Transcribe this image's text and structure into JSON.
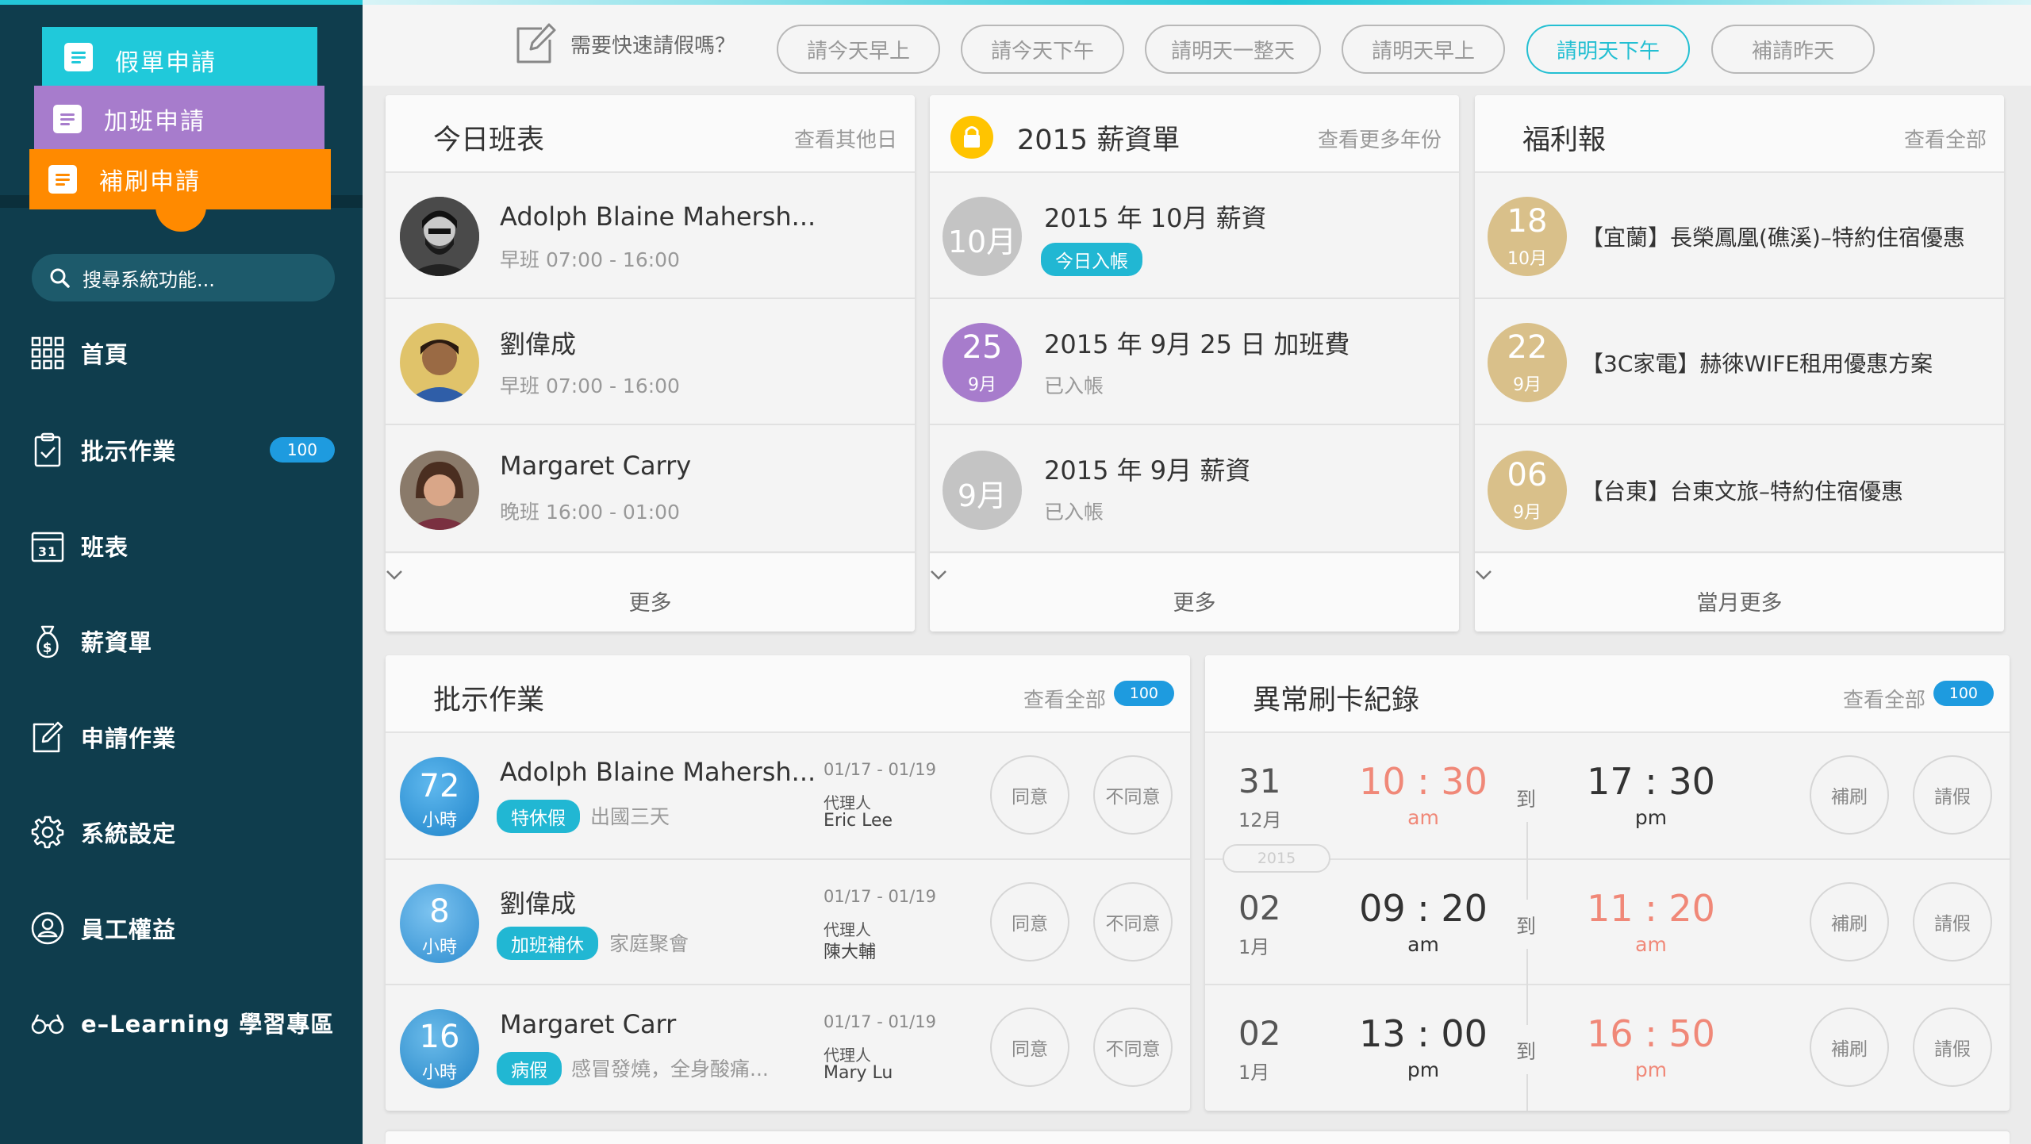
{
  "sidebar": {
    "leave_btn": "假單申請",
    "overtime_btn": "加班申請",
    "punch_btn": "補刷申請",
    "search_placeholder": "搜尋系統功能...",
    "nav": [
      {
        "label": "首頁",
        "icon": "grid-icon"
      },
      {
        "label": "批示作業",
        "icon": "clipboard-check-icon",
        "badge": "100"
      },
      {
        "label": "班表",
        "icon": "calendar-icon"
      },
      {
        "label": "薪資單",
        "icon": "money-bag-icon"
      },
      {
        "label": "申請作業",
        "icon": "edit-icon"
      },
      {
        "label": "系統設定",
        "icon": "gear-icon"
      },
      {
        "label": "員工權益",
        "icon": "user-badge-icon"
      },
      {
        "label": "e–Learning 學習專區",
        "icon": "glasses-icon"
      }
    ]
  },
  "quickbar": {
    "question": "需要快速請假嗎？",
    "buttons": [
      "請今天早上",
      "請今天下午",
      "請明天一整天",
      "請明天早上",
      "請明天下午",
      "補請昨天"
    ],
    "active_index": 4
  },
  "schedule": {
    "title": "今日班表",
    "link": "查看其他日",
    "rows": [
      {
        "name": "Adolph Blaine Mahersh...",
        "shift": "早班 07:00 - 16:00"
      },
      {
        "name": "劉偉成",
        "shift": "早班 07:00 - 16:00"
      },
      {
        "name": "Margaret Carry",
        "shift": "晚班 16:00 - 01:00"
      }
    ],
    "more": "更多"
  },
  "payroll": {
    "title": "2015 薪資單",
    "link": "查看更多年份",
    "rows": [
      {
        "circle": "10月",
        "title": "2015 年 10月 薪資",
        "status": "今日入帳"
      },
      {
        "circle_big": "25",
        "circle_small": "9月",
        "title": "2015 年 9月 25 日 加班費",
        "status": "已入帳"
      },
      {
        "circle": "9月",
        "title": "2015 年 9月 薪資",
        "status": "已入帳"
      }
    ],
    "more": "更多"
  },
  "welfare": {
    "title": "福利報",
    "link": "查看全部",
    "rows": [
      {
        "day": "18",
        "month": "10月",
        "text": "【宜蘭】長榮鳳凰(礁溪)–特約住宿優惠"
      },
      {
        "day": "22",
        "month": "9月",
        "text": "【3C家電】赫徠WIFE租用優惠方案"
      },
      {
        "day": "06",
        "month": "9月",
        "text": "【台東】台東文旅–特約住宿優惠"
      }
    ],
    "more": "當月更多"
  },
  "approval": {
    "title": "批示作業",
    "link": "查看全部",
    "badge": "100",
    "approve": "同意",
    "reject": "不同意",
    "rows": [
      {
        "hours": "72",
        "unit": "小時",
        "name": "Adolph Blaine Mahersh...",
        "tag": "特休假",
        "reason": "出國三天",
        "range": "01/17 - 01/19",
        "agent_label": "代理人",
        "agent": "Eric Lee"
      },
      {
        "hours": "8",
        "unit": "小時",
        "name": "劉偉成",
        "tag": "加班補休",
        "reason": "家庭聚會",
        "range": "01/17 - 01/19",
        "agent_label": "代理人",
        "agent": "陳大輔"
      },
      {
        "hours": "16",
        "unit": "小時",
        "name": "Margaret Carr",
        "tag": "病假",
        "reason": "感冒發燒，全身酸痛...",
        "range": "01/17 - 01/19",
        "agent_label": "代理人",
        "agent": "Mary Lu"
      }
    ]
  },
  "abnormal": {
    "title": "異常刷卡紀錄",
    "link": "查看全部",
    "badge": "100",
    "to": "到",
    "fix": "補刷",
    "leave": "請假",
    "year_tag": "2015",
    "rows": [
      {
        "day": "31",
        "month": "12月",
        "in_h": "10",
        "in_m": "30",
        "in_ap": "am",
        "in_flag": true,
        "out_h": "17",
        "out_m": "30",
        "out_ap": "pm",
        "out_flag": false
      },
      {
        "day": "02",
        "month": "1月",
        "in_h": "09",
        "in_m": "20",
        "in_ap": "am",
        "in_flag": false,
        "out_h": "11",
        "out_m": "20",
        "out_ap": "am",
        "out_flag": true
      },
      {
        "day": "02",
        "month": "1月",
        "in_h": "13",
        "in_m": "00",
        "in_ap": "pm",
        "in_flag": false,
        "out_h": "16",
        "out_m": "50",
        "out_ap": "pm",
        "out_flag": true
      }
    ]
  },
  "colors": {
    "accent": "#23c7d8",
    "sidebar": "#0f3d4d",
    "leave": "#20c9da",
    "overtime": "#a77ccc",
    "punch": "#ff8a00",
    "badge": "#1e9bdf",
    "welfare_gold": "#d9c08a",
    "pay_purple": "#a77ccc",
    "warning_red": "#f08878"
  }
}
